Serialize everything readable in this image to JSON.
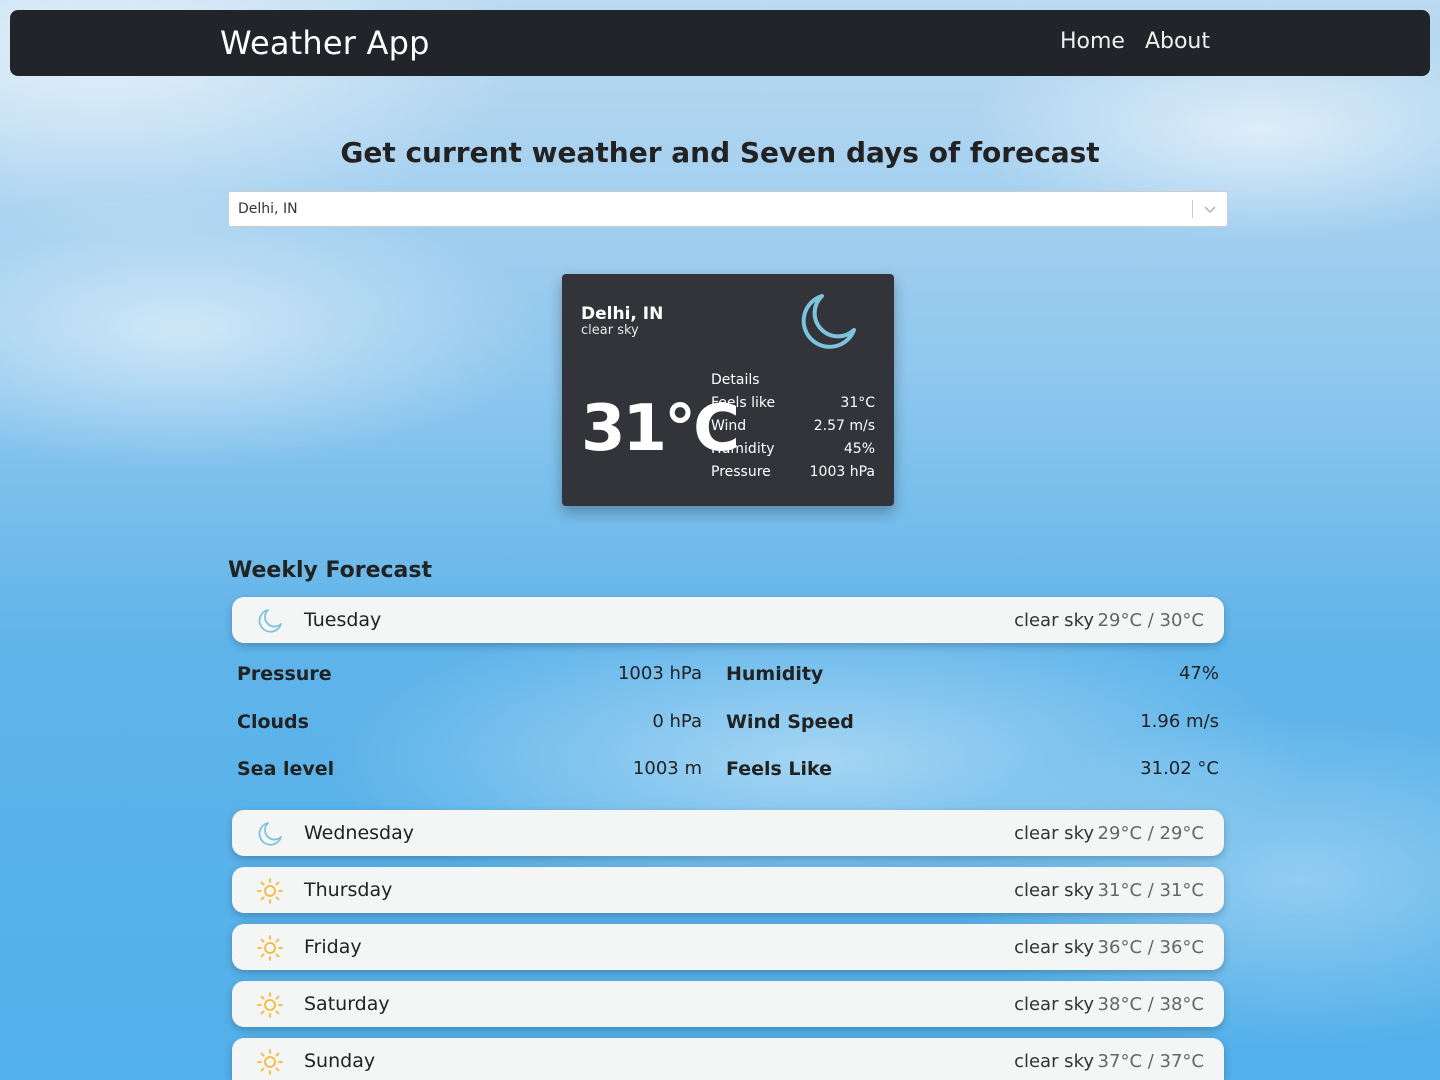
{
  "navbar": {
    "brand": "Weather App",
    "links": [
      "Home",
      "About"
    ]
  },
  "headline": "Get current weather and Seven days of forecast",
  "search": {
    "value": "Delhi, IN"
  },
  "current": {
    "city": "Delhi, IN",
    "description": "clear sky",
    "temperature": "31°C",
    "icon": "moon-icon",
    "details_title": "Details",
    "details": [
      {
        "label": "Feels like",
        "value": "31°C"
      },
      {
        "label": "Wind",
        "value": "2.57 m/s"
      },
      {
        "label": "Humidity",
        "value": "45%"
      },
      {
        "label": "Pressure",
        "value": "1003 hPa"
      }
    ]
  },
  "weekly": {
    "title": "Weekly Forecast",
    "days": [
      {
        "name": "Tuesday",
        "description": "clear sky",
        "temps": "29°C / 30°C",
        "icon": "moon-icon"
      },
      {
        "name": "Wednesday",
        "description": "clear sky",
        "temps": "29°C / 29°C",
        "icon": "moon-icon"
      },
      {
        "name": "Thursday",
        "description": "clear sky",
        "temps": "31°C / 31°C",
        "icon": "sun-icon"
      },
      {
        "name": "Friday",
        "description": "clear sky",
        "temps": "36°C / 36°C",
        "icon": "sun-icon"
      },
      {
        "name": "Saturday",
        "description": "clear sky",
        "temps": "38°C / 38°C",
        "icon": "sun-icon"
      },
      {
        "name": "Sunday",
        "description": "clear sky",
        "temps": "37°C / 37°C",
        "icon": "sun-icon"
      }
    ],
    "expanded_details": [
      {
        "left_label": "Pressure",
        "left_value": "1003 hPa",
        "right_label": "Humidity",
        "right_value": "47%"
      },
      {
        "left_label": "Clouds",
        "left_value": "0 hPa",
        "right_label": "Wind Speed",
        "right_value": "1.96 m/s"
      },
      {
        "left_label": "Sea level",
        "left_value": "1003 m",
        "right_label": "Feels Like",
        "right_value": "31.02 °C"
      }
    ]
  },
  "colors": {
    "navbar": "#212529",
    "card": "#333439",
    "moon": "#7ec3dd",
    "sun": "#f5b93b"
  }
}
